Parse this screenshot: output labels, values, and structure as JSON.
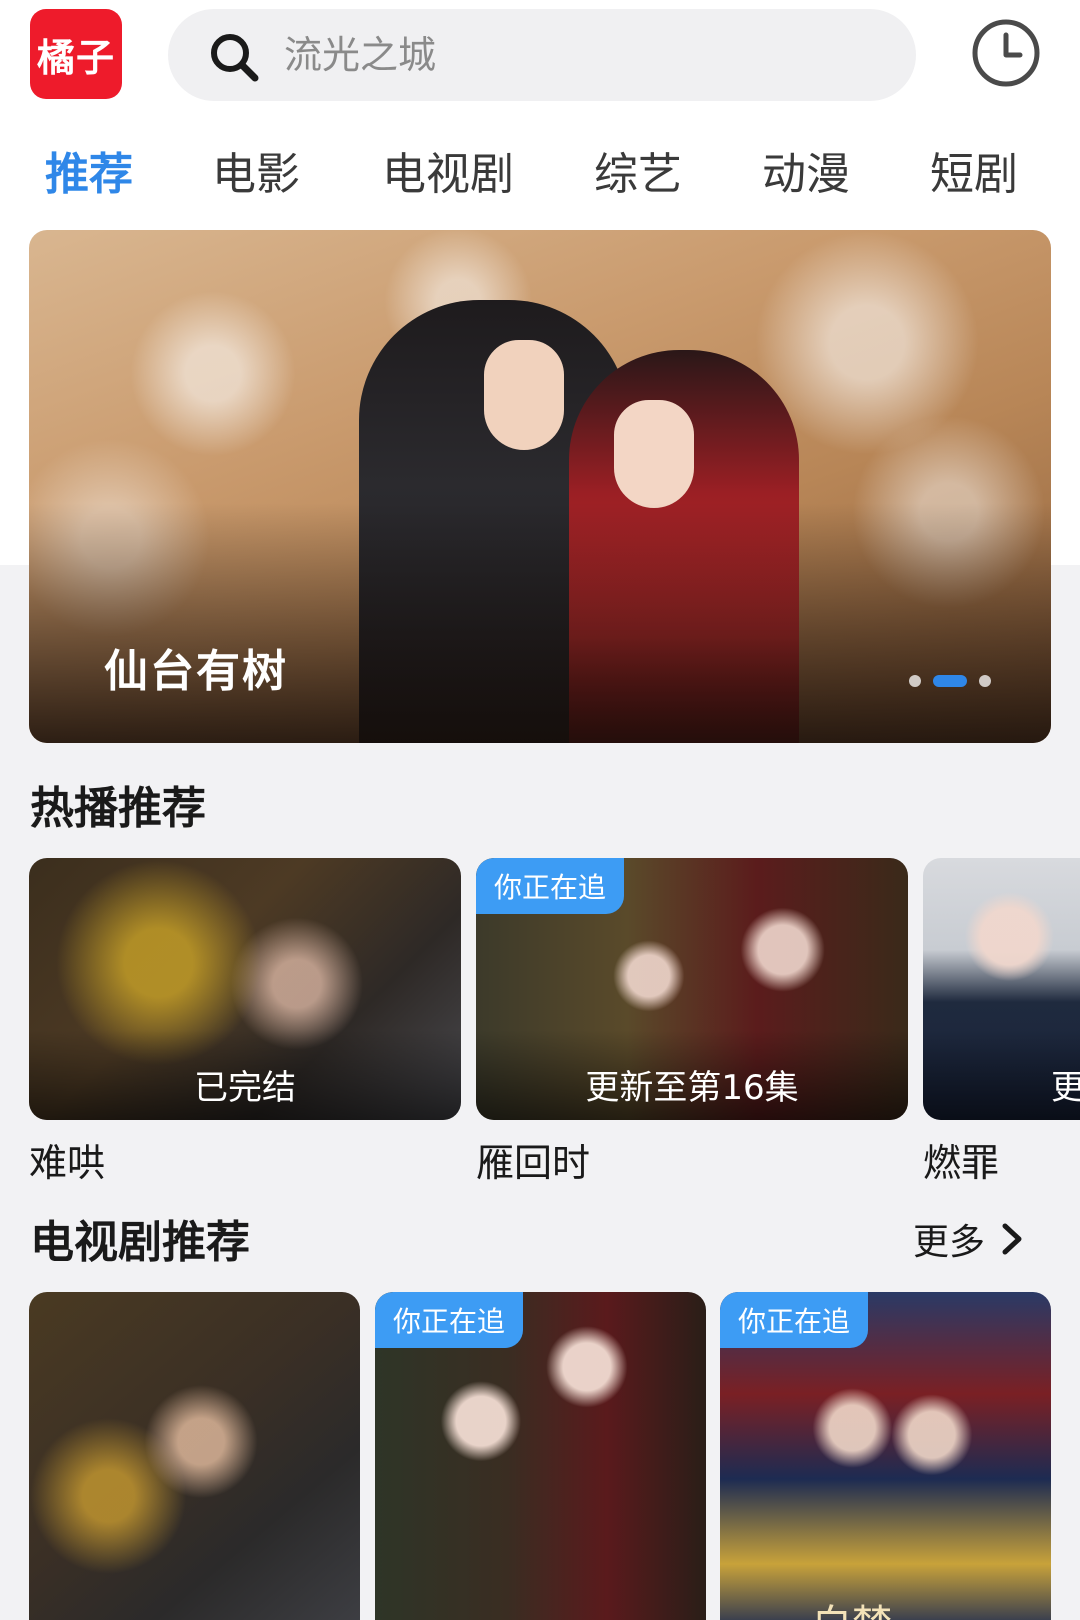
{
  "header": {
    "logo_text": "橘子",
    "search_placeholder": "流光之城"
  },
  "tabs": [
    {
      "label": "推荐",
      "active": true
    },
    {
      "label": "电影",
      "active": false
    },
    {
      "label": "电视剧",
      "active": false
    },
    {
      "label": "综艺",
      "active": false
    },
    {
      "label": "动漫",
      "active": false
    },
    {
      "label": "短剧",
      "active": false
    }
  ],
  "banner": {
    "title": "仙台有树",
    "dots_total": 3,
    "dots_active_index": 1
  },
  "hot": {
    "title": "热播推荐",
    "items": [
      {
        "name": "难哄",
        "status": "已完结",
        "badge": ""
      },
      {
        "name": "雁回时",
        "status": "更新至第16集",
        "badge": "你正在追"
      },
      {
        "name": "燃罪",
        "status": "更",
        "badge": ""
      }
    ]
  },
  "tv": {
    "title": "电视剧推荐",
    "more_label": "更多",
    "items": [
      {
        "badge": ""
      },
      {
        "badge": "你正在追"
      },
      {
        "badge": "你正在追",
        "poster_text": "白梦"
      }
    ]
  },
  "colors": {
    "accent": "#2f87e8",
    "logo_bg": "#ee1b2b",
    "badge_bg": "#3d9cf4"
  }
}
